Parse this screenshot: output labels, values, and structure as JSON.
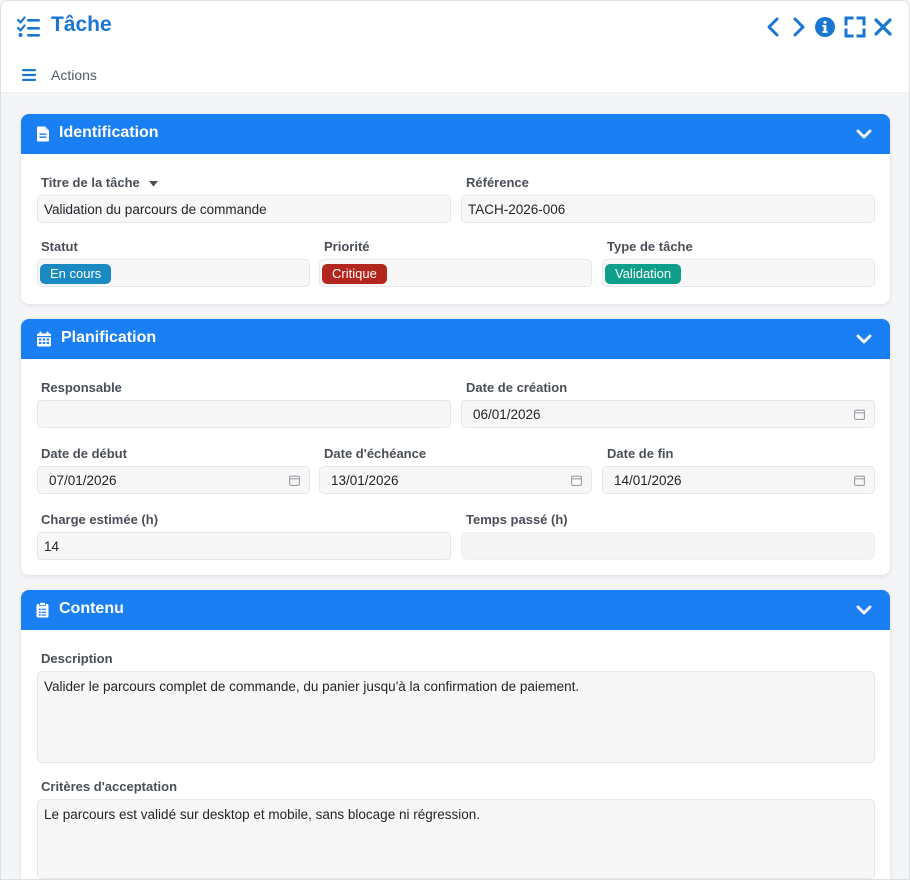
{
  "window": {
    "title": "Tâche",
    "toolbar": {
      "actions_label": "Actions"
    }
  },
  "colors": {
    "brand": "#1a7ff2",
    "title": "#1976d2",
    "status_en_cours": "#1a8ac2",
    "priority_critique": "#b3261e",
    "type_validation": "#0e9e8a"
  },
  "icons": {
    "title": "tasks-checklist-icon",
    "prev": "chevron-left-icon",
    "next": "chevron-right-icon",
    "info": "info-circle-icon",
    "expand": "expand-icon",
    "close": "close-icon",
    "menu": "hamburger-menu-icon"
  },
  "sections": {
    "identification": {
      "title": "Identification",
      "titre_label": "Titre de la tâche",
      "titre_value": "Validation du parcours de commande",
      "reference_label": "Référence",
      "reference_value": "TACH-2026-006",
      "statut_label": "Statut",
      "statut_value": "En cours",
      "priorite_label": "Priorité",
      "priorite_value": "Critique",
      "type_label": "Type de tâche",
      "type_value": "Validation"
    },
    "planification": {
      "title": "Planification",
      "responsable_label": "Responsable",
      "responsable_value": "",
      "date_creation_label": "Date de création",
      "date_creation_value": "06/01/2026",
      "date_debut_label": "Date de début",
      "date_debut_value": "07/01/2026",
      "date_echeance_label": "Date d'échéance",
      "date_echeance_value": "13/01/2026",
      "date_fin_label": "Date de fin",
      "date_fin_value": "14/01/2026",
      "charge_label": "Charge estimée (h)",
      "charge_value": "14",
      "temps_label": "Temps passé (h)",
      "temps_value": ""
    },
    "contenu": {
      "title": "Contenu",
      "description_label": "Description",
      "description_value": "Valider le parcours complet de commande, du panier jusqu'à la confirmation de paiement.",
      "criteres_label": "Critères d'acceptation",
      "criteres_value": "Le parcours est validé sur desktop et mobile, sans blocage ni régression."
    }
  }
}
